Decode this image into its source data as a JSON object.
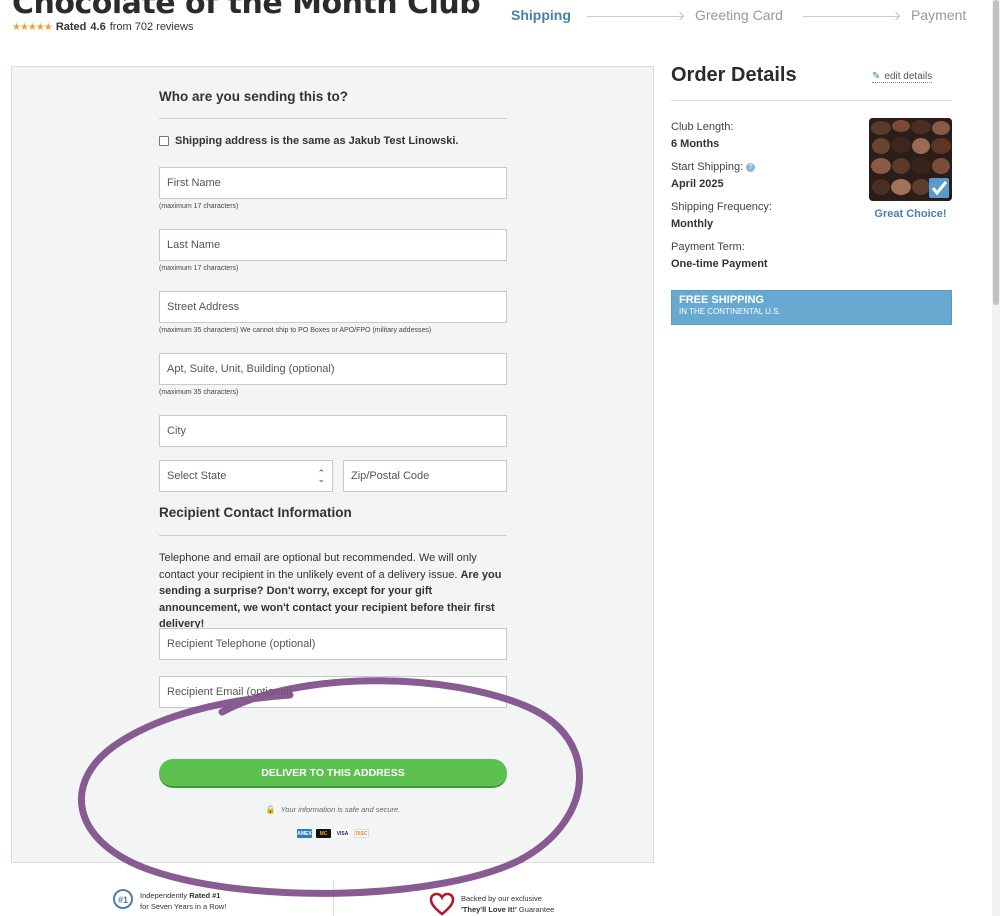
{
  "header": {
    "title": "Chocolate of the Month Club",
    "rating_prefix": "Rated",
    "rating_value": "4.6",
    "rating_suffix": "from 702 reviews",
    "star_count": 4.5
  },
  "steps": [
    {
      "label": "Shipping",
      "active": true
    },
    {
      "label": "Greeting Card",
      "active": false
    },
    {
      "label": "Payment",
      "active": false
    }
  ],
  "form": {
    "heading": "Who are you sending this to?",
    "same_address_label": "Shipping address is the same as Jakub Test Linowski.",
    "fields": {
      "first_name": {
        "placeholder": "First Name",
        "hint": "(maximum 17 characters)"
      },
      "last_name": {
        "placeholder": "Last Name",
        "hint": "(maximum 17 characters)"
      },
      "street": {
        "placeholder": "Street Address",
        "hint": "(maximum 35 characters) We cannot ship to PO Boxes or APO/FPO (military addesses)"
      },
      "apt": {
        "placeholder": "Apt, Suite, Unit, Building (optional)",
        "hint": "(maximum 35 characters)"
      },
      "city": {
        "placeholder": "City"
      },
      "state": {
        "value": "Select State"
      },
      "zip": {
        "placeholder": "Zip/Postal Code"
      }
    },
    "contact_heading": "Recipient Contact Information",
    "contact_text_plain": "Telephone and email are optional but recommended. We will only contact your recipient in the unlikely event of a delivery issue.",
    "contact_text_bold": "Are you sending a surprise? Don't worry, except for your gift announcement, we won't contact your recipient before their first delivery!",
    "telephone_placeholder": "Recipient Telephone (optional)",
    "email_placeholder": "Recipient Email (optional)",
    "submit_label": "DELIVER TO THIS ADDRESS",
    "secure_text": "Your information is safe and secure.",
    "cards": [
      "AMEX",
      "MC",
      "VISA",
      "DISC"
    ]
  },
  "order": {
    "title": "Order Details",
    "edit_label": "edit details",
    "items": [
      {
        "label": "Club Length:",
        "value": "6 Months"
      },
      {
        "label": "Start Shipping:",
        "value": "April 2025"
      },
      {
        "label": "Shipping Frequency:",
        "value": "Monthly"
      },
      {
        "label": "Payment Term:",
        "value": "One-time Payment"
      }
    ],
    "great_choice": "Great Choice!",
    "free_shipping_title": "FREE SHIPPING",
    "free_shipping_sub": "IN THE CONTINENTAL U.S."
  },
  "footer": {
    "badge1_pre": "Independently",
    "badge1_bold": "Rated #1",
    "badge1_post": "for Seven Years in a Row!",
    "badge2_pre": "Backed by our exclusive",
    "badge2_bold": "'They'll Love It!'",
    "badge2_post": "Guarantee"
  },
  "colors": {
    "accent_blue": "#4a7fa8",
    "cta_green": "#5cc14f",
    "free_shipping_bg": "#67a9d1",
    "annotation_purple": "#7b4a86"
  }
}
